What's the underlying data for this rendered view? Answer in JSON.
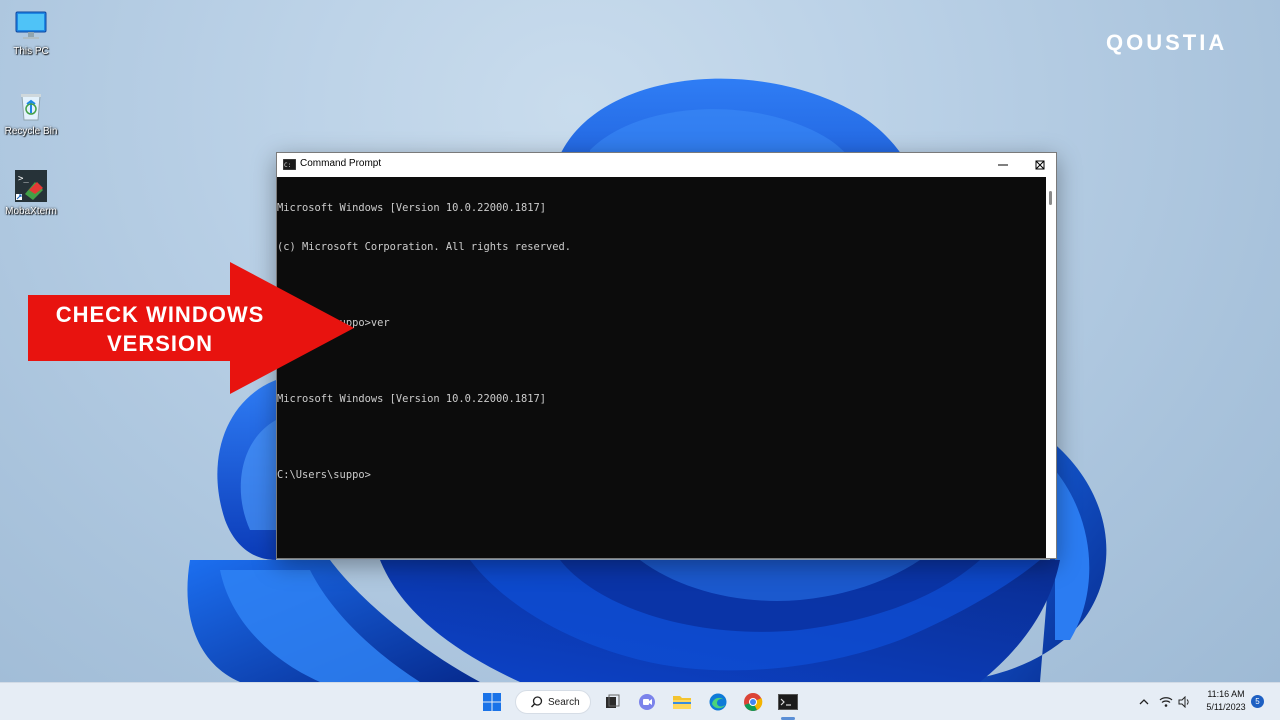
{
  "desktop": {
    "icons": [
      {
        "label": "This PC"
      },
      {
        "label": "Recycle Bin"
      },
      {
        "label": "MobaXterm"
      }
    ],
    "brand": "QOUSTIA"
  },
  "callout": {
    "line1": "CHECK WINDOWS",
    "line2": "VERSION",
    "color": "#e8130f"
  },
  "cmd_window": {
    "title": "Command Prompt",
    "console_lines": [
      "Microsoft Windows [Version 10.0.22000.1817]",
      "(c) Microsoft Corporation. All rights reserved.",
      "",
      "C:\\Users\\suppo>ver",
      "",
      "Microsoft Windows [Version 10.0.22000.1817]",
      "",
      "C:\\Users\\suppo>"
    ],
    "buttons": [
      "minimize-icon",
      "maximize-icon",
      "close-icon"
    ]
  },
  "taskbar": {
    "search_label": "Search",
    "apps": [
      "windows-start-icon",
      "search-icon",
      "task-view-icon",
      "teams-chat-icon",
      "file-explorer-icon",
      "edge-icon",
      "chrome-icon",
      "command-prompt-icon"
    ],
    "tray": {
      "time": "11:16 AM",
      "date": "5/11/2023",
      "notifications": "5"
    }
  },
  "colors": {
    "accent": "#1a5fd6",
    "console_bg": "#0c0c0c",
    "console_text": "#cccccc"
  }
}
